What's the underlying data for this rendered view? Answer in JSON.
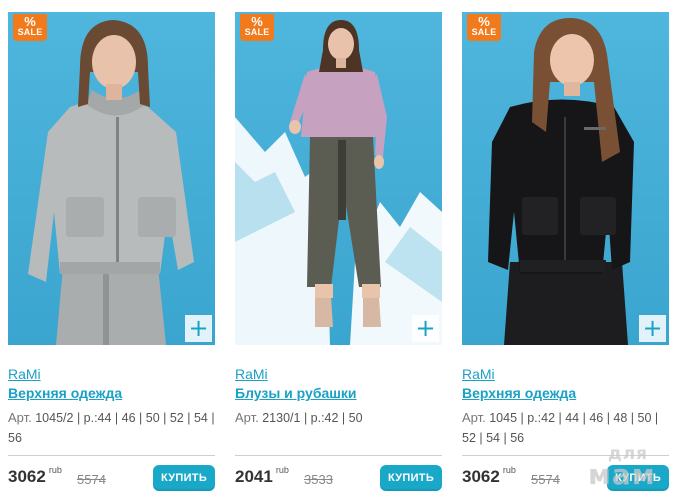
{
  "products": [
    {
      "badge": {
        "pct": "%",
        "text": "SALE"
      },
      "brand": "RaMi",
      "category": "Верхняя одежда",
      "article_label": "Арт.",
      "article": "1045/2 | р.:44 | 46 | 50 | 52 | 54 |",
      "article_cont": "56",
      "price": "3062",
      "currency": "rub",
      "old_price": "5574",
      "buy_label": "КУПИТЬ",
      "plus": "+",
      "photo": "woman-grey-hooded-jacket-and-trousers"
    },
    {
      "badge": {
        "pct": "%",
        "text": "SALE"
      },
      "brand": "RaMi",
      "category": "Блузы и рубашки",
      "article_label": "Арт.",
      "article": "2130/1 | р.:42 | 50",
      "article_cont": "",
      "price": "2041",
      "currency": "rub",
      "old_price": "3533",
      "buy_label": "КУПИТЬ",
      "plus": "+",
      "photo": "woman-pink-blouse-khaki-trousers-mountains"
    },
    {
      "badge": {
        "pct": "%",
        "text": "SALE"
      },
      "brand": "RaMi",
      "category": "Верхняя одежда",
      "article_label": "Арт.",
      "article": "1045 | р.:42 | 44 | 46 | 48 | 50 |",
      "article_cont": "52 | 54 | 56",
      "price": "3062",
      "currency": "rub",
      "old_price": "5574",
      "buy_label": "КУПИТЬ",
      "plus": "+",
      "photo": "woman-black-hooded-jacket-and-trousers"
    }
  ],
  "watermark": {
    "line1": "для",
    "line2": "мам"
  },
  "colors": {
    "accent": "#1aa1c6",
    "button": "#1aa8c9",
    "sale": "#f07a1c",
    "photo_bg": "#4fb6dd"
  }
}
